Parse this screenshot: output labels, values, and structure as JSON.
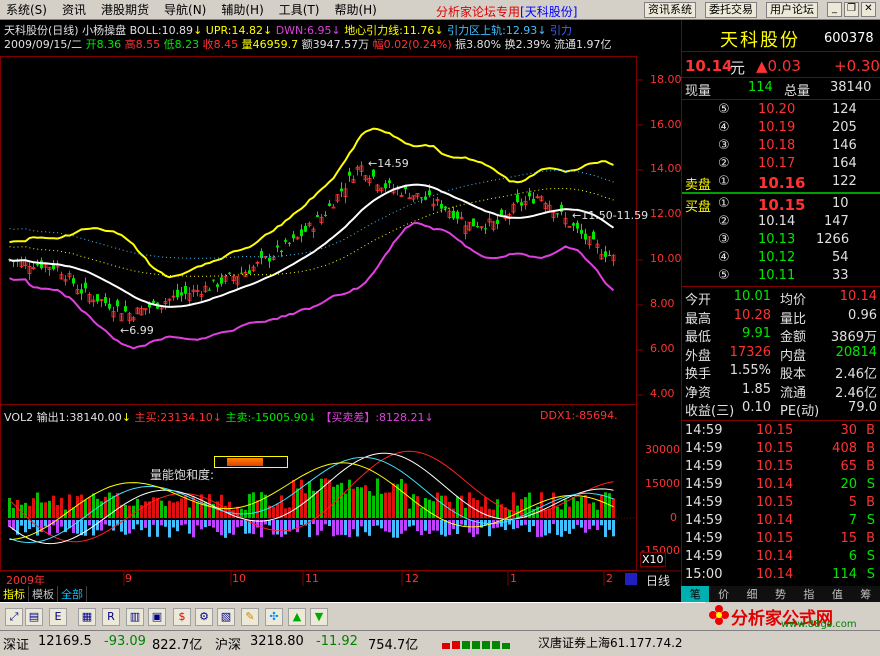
{
  "menu": {
    "items": [
      "系统(S)",
      "资讯",
      "港股期货",
      "导航(N)",
      "辅助(H)",
      "工具(T)",
      "帮助(H)"
    ],
    "center_title": "分析家论坛专用",
    "center_stock": "[天科股份]",
    "right_buttons": [
      "资讯系统",
      "委托交易",
      "用户论坛"
    ]
  },
  "chart_header": {
    "line1": {
      "name": "天科股份(日线) 小杨操盘",
      "boll": "BOLL:10.89",
      "upr": "UPR:14.82",
      "dwn": "DWN:6.95",
      "mid": "地心引力线:11.76",
      "upband": "引力区上轨:12.93",
      "extra": "引力"
    },
    "line2": {
      "date": "2009/09/15/二",
      "open": "开8.36",
      "high": "高8.55",
      "low": "低8.23",
      "close": "收8.45",
      "vol": "量46959.7",
      "amount": "额3947.57万",
      "change": "幅0.02(0.24%)",
      "amp": "振3.80%",
      "turnover": "换2.39%",
      "float": "流通1.97亿"
    }
  },
  "price_axis": [
    "18.00",
    "16.00",
    "14.00",
    "12.00",
    "10.00",
    "8.00",
    "6.00",
    "4.00"
  ],
  "annotations": {
    "high": "←14.59",
    "low": "←6.99",
    "right": "←11.50-11.59"
  },
  "vol_header": {
    "title": "VOL2 输出1:38140.00",
    "main_buy": "主买:23134.10",
    "main_sell": "主卖:-15005.90",
    "diff": "【买卖差】:8128.21",
    "ddx": "DDX1:-85694."
  },
  "vol_axis": [
    "30000",
    "15000",
    "0",
    "-15000",
    "X10"
  ],
  "vol_label": "量能饱和度:",
  "date_axis": [
    "2009年",
    "9",
    "10",
    "11",
    "12",
    "1",
    "2"
  ],
  "period_label": "日线",
  "tabs": [
    "指标",
    "模板",
    "全部"
  ],
  "quote": {
    "name": "天科股份",
    "code": "600378",
    "price": "10.14",
    "price_unit": "元",
    "change": "▲0.03",
    "pct": "+0.30",
    "now_vol_label": "现量",
    "now_vol": "114",
    "total_label": "总量",
    "total": "38140",
    "sell": [
      {
        "lv": "⑤",
        "price": "10.20",
        "vol": "124"
      },
      {
        "lv": "④",
        "price": "10.19",
        "vol": "205"
      },
      {
        "lv": "③",
        "price": "10.18",
        "vol": "146"
      },
      {
        "lv": "②",
        "price": "10.17",
        "vol": "164"
      },
      {
        "lv": "①",
        "price": "10.16",
        "vol": "122"
      }
    ],
    "sell_label": "卖盘",
    "buy_label": "买盘",
    "buy": [
      {
        "lv": "①",
        "price": "10.15",
        "vol": "10"
      },
      {
        "lv": "②",
        "price": "10.14",
        "vol": "147"
      },
      {
        "lv": "③",
        "price": "10.13",
        "vol": "1266"
      },
      {
        "lv": "④",
        "price": "10.12",
        "vol": "54"
      },
      {
        "lv": "⑤",
        "price": "10.11",
        "vol": "33"
      }
    ],
    "stats": [
      {
        "l1": "今开",
        "v1": "10.01",
        "c1": "green",
        "l2": "均价",
        "v2": "10.14",
        "c2": "red"
      },
      {
        "l1": "最高",
        "v1": "10.28",
        "c1": "red",
        "l2": "量比",
        "v2": "0.96",
        "c2": "white"
      },
      {
        "l1": "最低",
        "v1": "9.91",
        "c1": "green",
        "l2": "金额",
        "v2": "3869万",
        "c2": "white"
      },
      {
        "l1": "外盘",
        "v1": "17326",
        "c1": "red",
        "l2": "内盘",
        "v2": "20814",
        "c2": "green"
      },
      {
        "l1": "换手",
        "v1": "1.55%",
        "c1": "white",
        "l2": "股本",
        "v2": "2.46亿",
        "c2": "white"
      },
      {
        "l1": "净资",
        "v1": "1.85",
        "c1": "white",
        "l2": "流通",
        "v2": "2.46亿",
        "c2": "white"
      },
      {
        "l1": "收益(三)",
        "v1": "0.10",
        "c1": "white",
        "l2": "PE(动)",
        "v2": "79.0",
        "c2": "white"
      }
    ],
    "ticks": [
      {
        "t": "14:59",
        "p": "10.15",
        "v": "30",
        "d": "B"
      },
      {
        "t": "14:59",
        "p": "10.15",
        "v": "408",
        "d": "B"
      },
      {
        "t": "14:59",
        "p": "10.15",
        "v": "65",
        "d": "B"
      },
      {
        "t": "14:59",
        "p": "10.14",
        "v": "20",
        "d": "S"
      },
      {
        "t": "14:59",
        "p": "10.15",
        "v": "5",
        "d": "B"
      },
      {
        "t": "14:59",
        "p": "10.14",
        "v": "7",
        "d": "S"
      },
      {
        "t": "14:59",
        "p": "10.15",
        "v": "15",
        "d": "B"
      },
      {
        "t": "14:59",
        "p": "10.14",
        "v": "6",
        "d": "S"
      },
      {
        "t": "15:00",
        "p": "10.14",
        "v": "114",
        "d": "S"
      }
    ],
    "rtabs": [
      "笔",
      "价",
      "细",
      "势",
      "指",
      "值",
      "筹"
    ]
  },
  "logo": {
    "text": "分析家公式网",
    "url": "www.88gs.com"
  },
  "status": {
    "sz_label": "深证",
    "sz_val": "12169.5",
    "sz_chg": "-93.09",
    "sz_amt": "822.7亿",
    "hs_label": "沪深",
    "hs_val": "3218.80",
    "hs_chg": "-11.92",
    "hs_amt": "754.7亿",
    "broker": "汉唐证券上海61.177.74.2"
  },
  "colors": {
    "up": "#ff3232",
    "down": "#00e600",
    "upper_band": "#ffff00",
    "lower_band": "#e040e0",
    "mid_line": "#ffffff"
  }
}
